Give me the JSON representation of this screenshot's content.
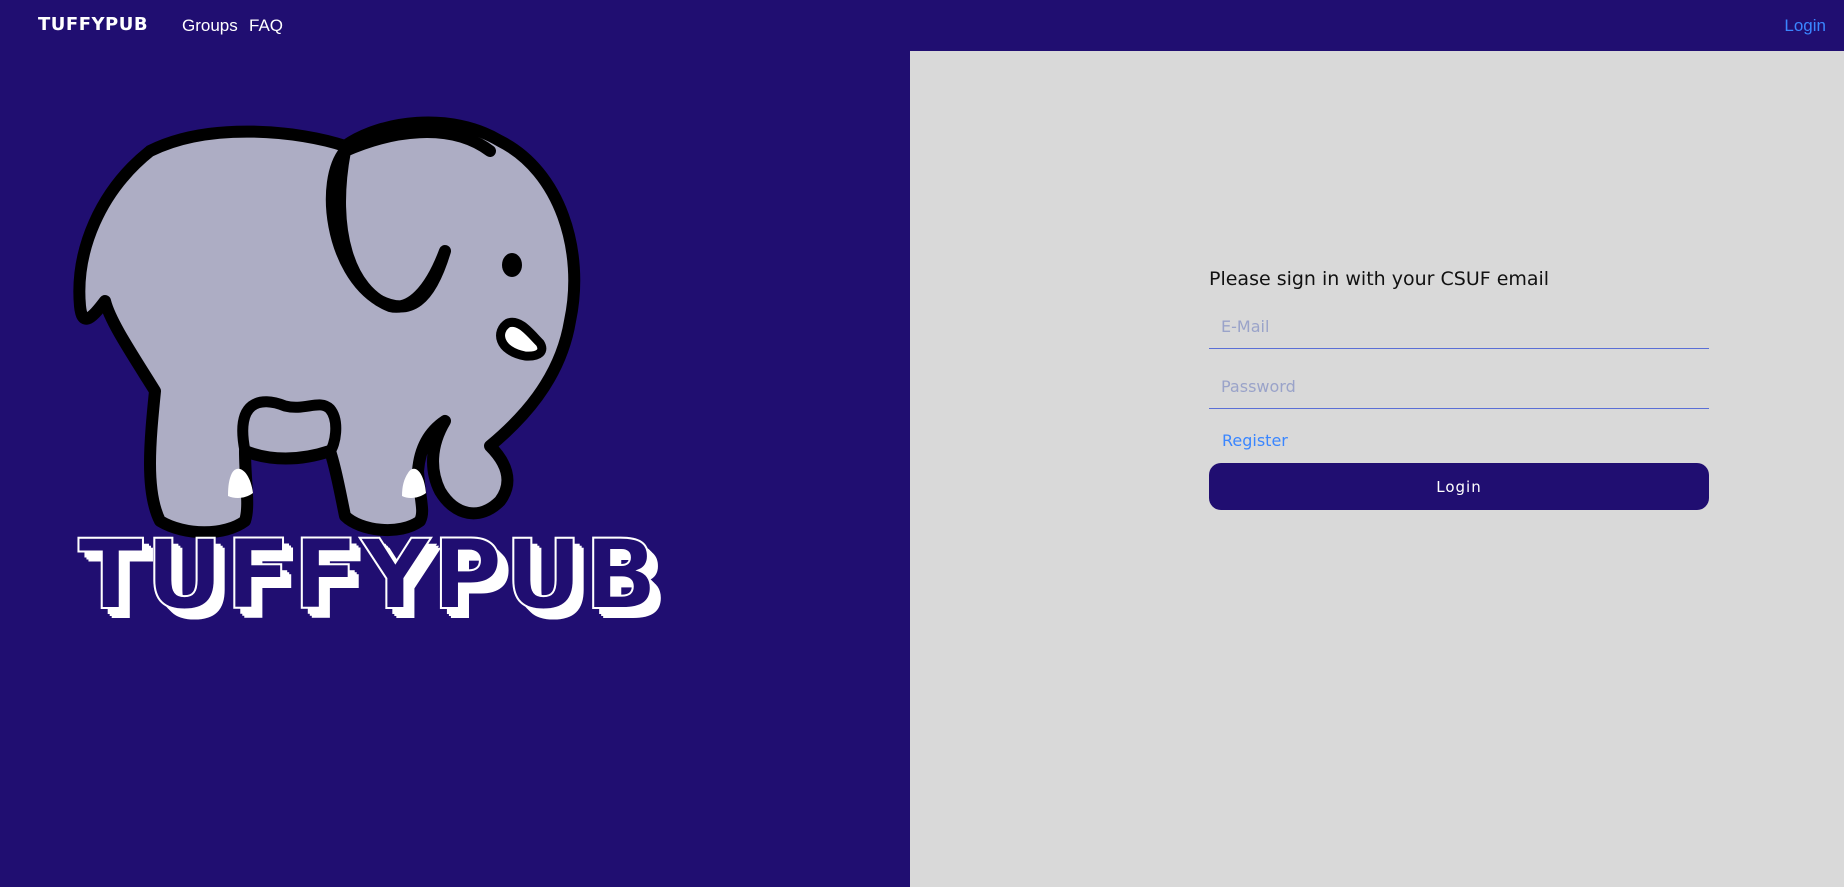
{
  "navbar": {
    "brand": "TUFFYPUB",
    "links": [
      "Groups",
      "FAQ"
    ],
    "login": "Login"
  },
  "hero": {
    "wordmark": "TUFFYPUB",
    "mascot_icon": "elephant-icon"
  },
  "login_form": {
    "title": "Please sign in with your CSUF email",
    "email_placeholder": "E-Mail",
    "password_placeholder": "Password",
    "register_label": "Register",
    "submit_label": "Login"
  },
  "colors": {
    "primary": "#200e71",
    "panel": "#d9d9d9",
    "link": "#3a86ff",
    "elephant_fill": "#adadc4"
  }
}
